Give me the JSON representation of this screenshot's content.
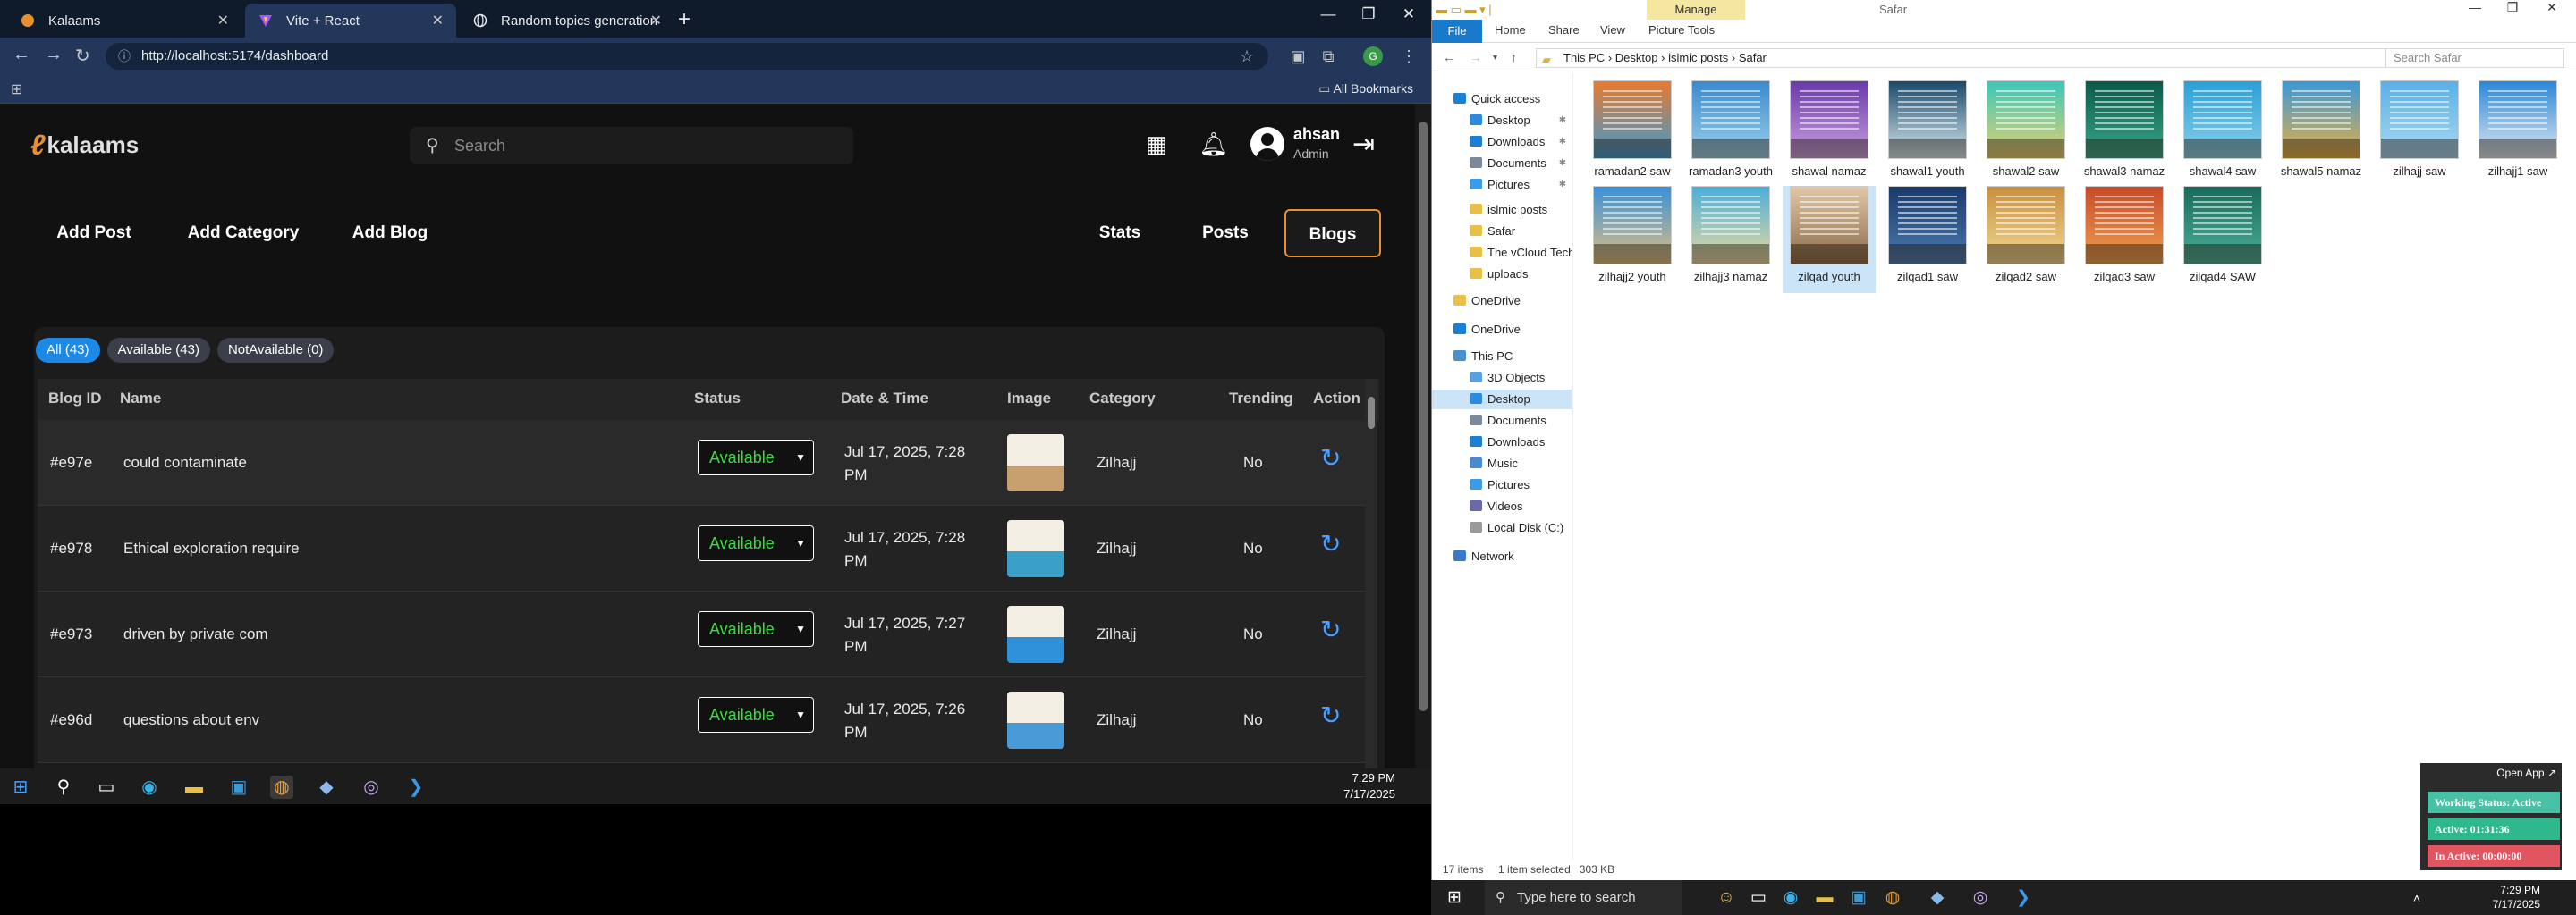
{
  "browser": {
    "tabs": [
      {
        "label": "Kalaams",
        "active": false
      },
      {
        "label": "Vite + React",
        "active": true
      },
      {
        "label": "Random topics generation",
        "active": false
      }
    ],
    "url": "http://localhost:5174/dashboard",
    "all_bookmarks": "All Bookmarks"
  },
  "app": {
    "logo": "kalaams",
    "search_placeholder": "Search",
    "user": {
      "name": "ahsan",
      "role": "Admin"
    },
    "actions": {
      "add_post": "Add Post",
      "add_category": "Add Category",
      "add_blog": "Add Blog"
    },
    "views": {
      "stats": "Stats",
      "posts": "Posts",
      "blogs": "Blogs"
    },
    "filters": {
      "all": "All (43)",
      "available": "Available (43)",
      "not_available": "NotAvailable (0)"
    },
    "columns": {
      "id": "Blog ID",
      "name": "Name",
      "status": "Status",
      "date": "Date & Time",
      "image": "Image",
      "category": "Category",
      "trending": "Trending",
      "action": "Action"
    },
    "rows": [
      {
        "id": "#e97e",
        "name": "could contaminate",
        "status": "Available",
        "date1": "Jul 17, 2025, 7:28",
        "date2": "PM",
        "category": "Zilhajj",
        "trending": "No",
        "thumb": "#c8a070"
      },
      {
        "id": "#e978",
        "name": "Ethical exploration require",
        "status": "Available",
        "date1": "Jul 17, 2025, 7:28",
        "date2": "PM",
        "category": "Zilhajj",
        "trending": "No",
        "thumb": "#3aa0c8"
      },
      {
        "id": "#e973",
        "name": "driven by private com",
        "status": "Available",
        "date1": "Jul 17, 2025, 7:27",
        "date2": "PM",
        "category": "Zilhajj",
        "trending": "No",
        "thumb": "#2e90d8"
      },
      {
        "id": "#e96d",
        "name": "questions about env",
        "status": "Available",
        "date1": "Jul 17, 2025, 7:26",
        "date2": "PM",
        "category": "Zilhajj",
        "trending": "No",
        "thumb": "#4a9ad8"
      }
    ]
  },
  "left_taskbar": {
    "time": "7:29 PM",
    "date": "7/17/2025"
  },
  "explorer": {
    "title": "Safar",
    "manage": "Manage",
    "ribbon": {
      "file": "File",
      "home": "Home",
      "share": "Share",
      "view": "View",
      "picture_tools": "Picture Tools"
    },
    "path": {
      "p1": "This PC",
      "p2": "Desktop",
      "p3": "islmic posts",
      "p4": "Safar"
    },
    "search_placeholder": "Search Safar",
    "nav": [
      {
        "label": "Quick access",
        "color": "#1a7fd6",
        "pin": false
      },
      {
        "label": "Desktop",
        "color": "#2a8ae0",
        "pin": true
      },
      {
        "label": "Downloads",
        "color": "#1a7fd6",
        "pin": true
      },
      {
        "label": "Documents",
        "color": "#7a8a99",
        "pin": true
      },
      {
        "label": "Pictures",
        "color": "#3c9be8",
        "pin": true
      },
      {
        "label": "islmic posts",
        "color": "#e8c048",
        "pin": false
      },
      {
        "label": "Safar",
        "color": "#e8c048",
        "pin": false
      },
      {
        "label": "The vCloud Tech Blo",
        "color": "#e8c048",
        "pin": false
      },
      {
        "label": "uploads",
        "color": "#e8c048",
        "pin": false
      },
      {
        "label": "OneDrive",
        "color": "#e8c048",
        "pin": false
      },
      {
        "label": "OneDrive",
        "color": "#1a7fd6",
        "pin": false
      },
      {
        "label": "This PC",
        "color": "#4a90d0",
        "pin": false
      },
      {
        "label": "3D Objects",
        "color": "#5aa0e0",
        "pin": false
      },
      {
        "label": "Desktop",
        "color": "#2a8ae0",
        "pin": false,
        "selected": true
      },
      {
        "label": "Documents",
        "color": "#7a8a99",
        "pin": false
      },
      {
        "label": "Downloads",
        "color": "#1a7fd6",
        "pin": false
      },
      {
        "label": "Music",
        "color": "#4a8ad0",
        "pin": false
      },
      {
        "label": "Pictures",
        "color": "#3c9be8",
        "pin": false
      },
      {
        "label": "Videos",
        "color": "#6a6aa8",
        "pin": false
      },
      {
        "label": "Local Disk (C:)",
        "color": "#9a9a9a",
        "pin": false
      },
      {
        "label": "Network",
        "color": "#3a7ac8",
        "pin": false
      }
    ],
    "files": [
      {
        "name": "ramadan2 saw",
        "c1": "#e87a30",
        "c2": "#3a9ad0"
      },
      {
        "name": "ramadan3 youth",
        "c1": "#3a8ad0",
        "c2": "#9ad0e8"
      },
      {
        "name": "shawal namaz",
        "c1": "#6a3aa8",
        "c2": "#c8a0e0"
      },
      {
        "name": "shawal1 youth",
        "c1": "#1a4a6a",
        "c2": "#d8e8f0"
      },
      {
        "name": "shawal2 saw",
        "c1": "#3ac8b8",
        "c2": "#e8d070"
      },
      {
        "name": "shawal3 namaz",
        "c1": "#0a5a4a",
        "c2": "#3aa888"
      },
      {
        "name": "shawal4 saw",
        "c1": "#2aa0d8",
        "c2": "#8ad0e8"
      },
      {
        "name": "shawal5 namaz",
        "c1": "#3a98d8",
        "c2": "#e8b040"
      },
      {
        "name": "zilhajj saw",
        "c1": "#5ab0e8",
        "c2": "#a8d8f0"
      },
      {
        "name": "zilhajj1 saw",
        "c1": "#2a88d8",
        "c2": "#e0e8f0"
      },
      {
        "name": "zilhajj2 youth",
        "c1": "#3a90d8",
        "c2": "#e0c080"
      },
      {
        "name": "zilhajj3 namaz",
        "c1": "#4ab0d8",
        "c2": "#e8d8a0"
      },
      {
        "name": "zilqad youth",
        "c1": "#e0c8a8",
        "c2": "#8a6a4a",
        "selected": true
      },
      {
        "name": "zilqad1 saw",
        "c1": "#1a3a6a",
        "c2": "#4a7ab0"
      },
      {
        "name": "zilqad2 saw",
        "c1": "#c89040",
        "c2": "#f0d890"
      },
      {
        "name": "zilqad3 saw",
        "c1": "#c84a2a",
        "c2": "#f0a050"
      },
      {
        "name": "zilqad4 SAW",
        "c1": "#1a6a5a",
        "c2": "#4ab098"
      }
    ],
    "status": {
      "items": "17 items",
      "selected": "1 item selected",
      "size": "303 KB"
    }
  },
  "widget": {
    "open_app": "Open App",
    "working": "Working Status: Active",
    "active": "Active: 01:31:36",
    "inactive": "In Active: 00:00:00",
    "colors": {
      "working": "#49c1a5",
      "active": "#2fb88e",
      "inactive": "#e05560"
    }
  },
  "main_taskbar": {
    "search": "Type here to search",
    "time": "7:29 PM",
    "date": "7/17/2025"
  }
}
